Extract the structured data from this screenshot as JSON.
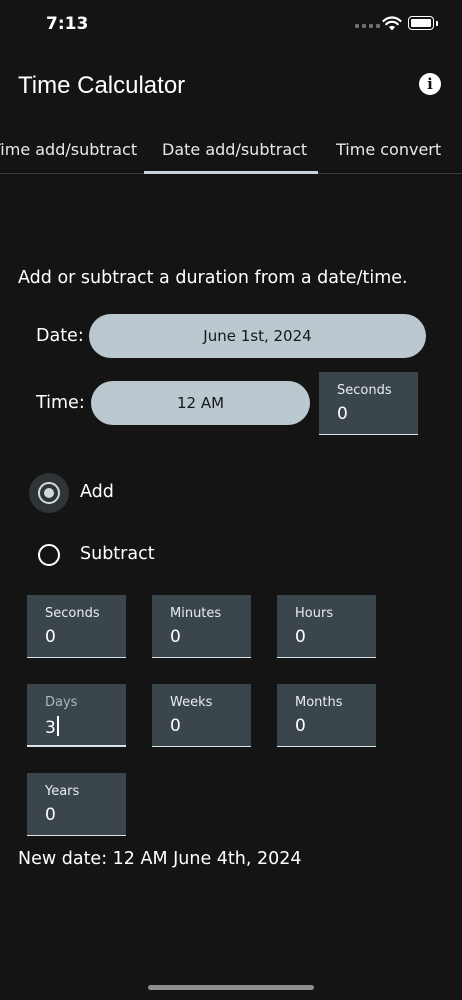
{
  "status_bar": {
    "time": "7:13"
  },
  "app_bar": {
    "title": "Time Calculator",
    "info_icon": "info-icon"
  },
  "tabs": [
    {
      "label": "Time add/subtract",
      "active": false
    },
    {
      "label": "Date add/subtract",
      "active": true
    },
    {
      "label": "Time convert",
      "active": false
    }
  ],
  "main": {
    "intro": "Add or subtract a duration from a date/time.",
    "date_label": "Date:",
    "date_value": "June 1st, 2024",
    "time_label": "Time:",
    "time_value": "12 AM",
    "time_seconds": {
      "label": "Seconds",
      "value": "0"
    },
    "operation": {
      "options": [
        "Add",
        "Subtract"
      ],
      "selected": "Add"
    },
    "duration_fields": [
      {
        "label": "Seconds",
        "value": "0"
      },
      {
        "label": "Minutes",
        "value": "0"
      },
      {
        "label": "Hours",
        "value": "0"
      },
      {
        "label": "Days",
        "value": "3"
      },
      {
        "label": "Weeks",
        "value": "0"
      },
      {
        "label": "Months",
        "value": "0"
      },
      {
        "label": "Years",
        "value": "0"
      }
    ],
    "result": "New date: 12 AM June 4th, 2024"
  },
  "colors": {
    "background": "#151415",
    "pill": "#bcc8d0",
    "field": "#3a454c",
    "indicator": "#c7d3db"
  }
}
